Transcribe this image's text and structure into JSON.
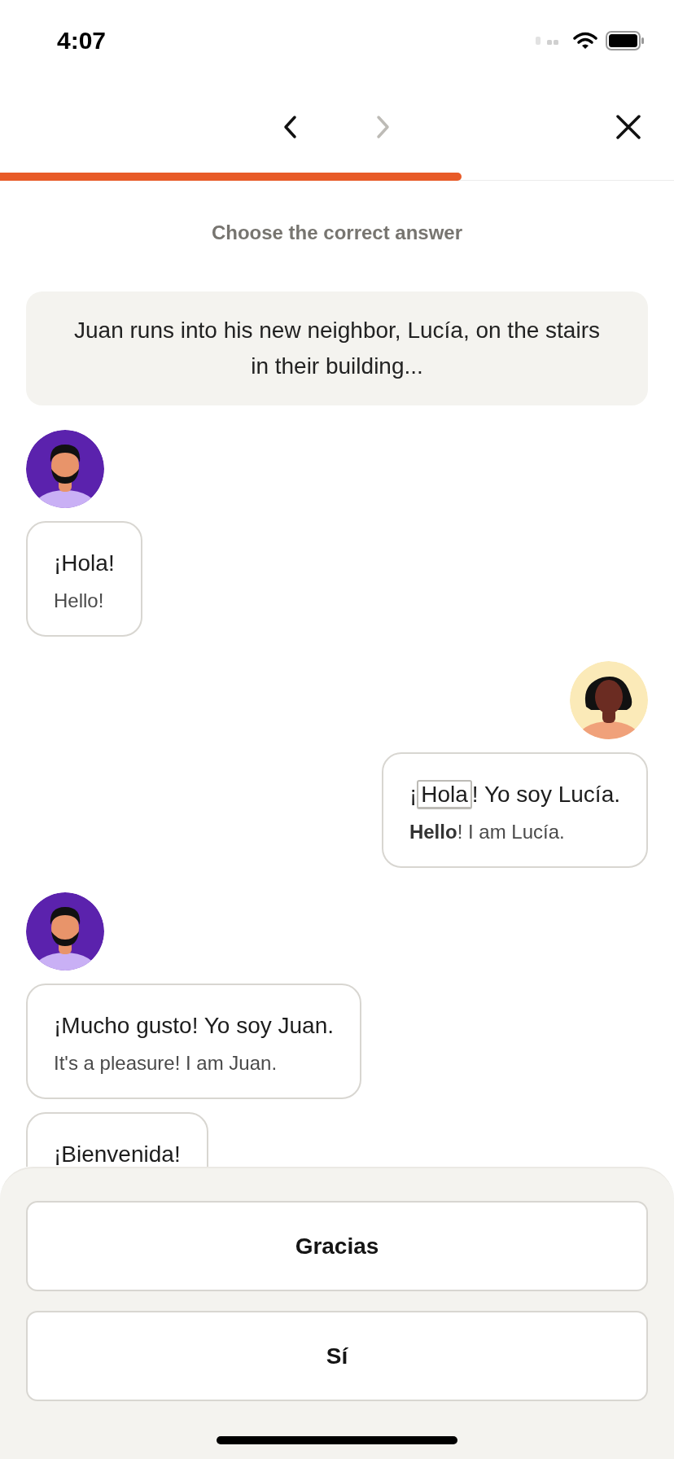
{
  "status_bar": {
    "time": "4:07"
  },
  "nav": {
    "back": {
      "disabled": false
    },
    "forward": {
      "disabled": true
    }
  },
  "progress": {
    "level": 0.685
  },
  "instruction": "Choose the correct answer",
  "context": "Juan runs into his new neighbor, Lucía, on the stairs in their building...",
  "turns": [
    {
      "outgoing": false,
      "color": "#5b22ad",
      "messages": [
        {
          "parts": [
            {
              "text": "¡Hola!",
              "highlighted": false
            }
          ],
          "translation": "Hello!"
        }
      ]
    },
    {
      "outgoing": true,
      "color": "#fbeab8",
      "messages": [
        {
          "parts": [
            {
              "text": "¡",
              "highlighted": false
            },
            {
              "text": "Hola",
              "highlighted": true
            },
            {
              "text": "! Yo soy Lucía.",
              "highlighted": false
            }
          ],
          "translation": "**Hello**! I am Lucía."
        }
      ]
    },
    {
      "outgoing": false,
      "color": "#5b22ad",
      "messages": [
        {
          "parts": [
            {
              "text": "¡Mucho gusto! Yo soy Juan.",
              "highlighted": false
            }
          ],
          "translation": "It's a pleasure! I am Juan."
        },
        {
          "parts": [
            {
              "text": "¡Bienvenida!",
              "highlighted": false
            }
          ]
        }
      ]
    }
  ],
  "answers": [
    {
      "label": "Gracias"
    },
    {
      "label": "Sí"
    }
  ]
}
